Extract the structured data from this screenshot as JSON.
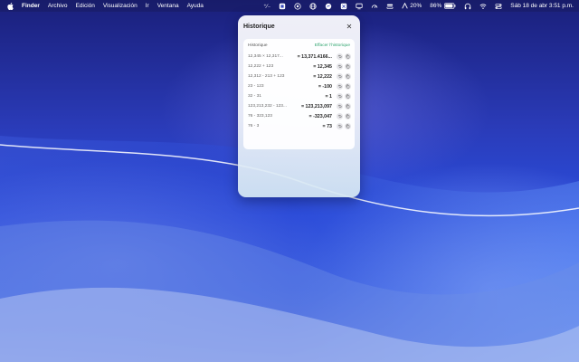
{
  "menubar": {
    "app_name": "Finder",
    "menus": [
      "Archivo",
      "Edición",
      "Visualización",
      "Ir",
      "Ventana",
      "Ayuda"
    ],
    "status": {
      "calculator_icon_label": "⁺⁄₋",
      "brightness_percent": "20%",
      "battery_percent": "86%",
      "datetime": "Sáb 18 de abr  3:51 p.m."
    }
  },
  "popover": {
    "title": "Historique",
    "history_label": "Historique",
    "clear_label": "Effacer l'historique",
    "rows": [
      {
        "expr": "12,345 × 12,317...",
        "result": "= 13,371.4166..."
      },
      {
        "expr": "12,222 + 123",
        "result": "= 12,345"
      },
      {
        "expr": "12,312 - 213 + 123",
        "result": "= 12,222"
      },
      {
        "expr": "23 - 123",
        "result": "= -100"
      },
      {
        "expr": "32 - 31",
        "result": "= 1"
      },
      {
        "expr": "123,213,232 - 123...",
        "result": "= 123,213,097"
      },
      {
        "expr": "76 - 323,123",
        "result": "= -323,047"
      },
      {
        "expr": "76 - 3",
        "result": "= 73"
      }
    ]
  }
}
